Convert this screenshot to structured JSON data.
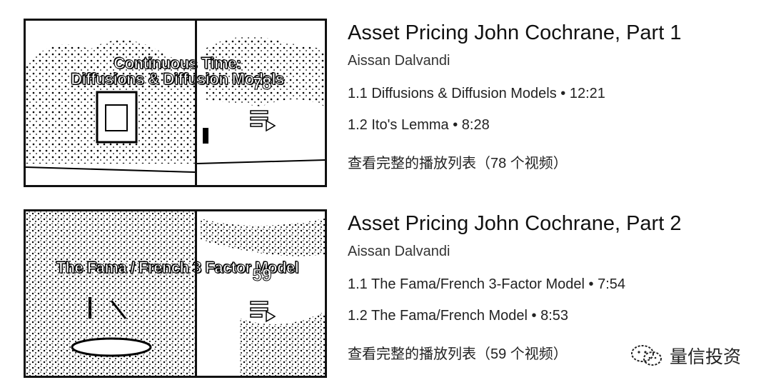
{
  "playlists": [
    {
      "title": "Asset Pricing John Cochrane, Part 1",
      "channel": "Aissan Dalvandi",
      "thumbnail_title_lines": [
        "Continuous Time:",
        "Diffusions & Diffusion Models"
      ],
      "video_count": "78",
      "videos": [
        {
          "label": "1.1 Diffusions & Diffusion Models • 12:21"
        },
        {
          "label": "1.2 Ito's Lemma • 8:28"
        }
      ],
      "view_full_playlist": "查看完整的播放列表（78 个视频）"
    },
    {
      "title": "Asset Pricing John Cochrane, Part 2",
      "channel": "Aissan Dalvandi",
      "thumbnail_title_lines": [
        "The Fama / French 3 Factor Model"
      ],
      "video_count": "59",
      "videos": [
        {
          "label": "1.1 The Fama/French 3-Factor Model • 7:54"
        },
        {
          "label": "1.2 The Fama/French Model • 8:53"
        }
      ],
      "view_full_playlist": "查看完整的播放列表（59 个视频）"
    }
  ],
  "watermark": {
    "text": "量信投资",
    "icon": "wechat-icon"
  },
  "icons": {
    "playlist": "playlist-icon"
  }
}
